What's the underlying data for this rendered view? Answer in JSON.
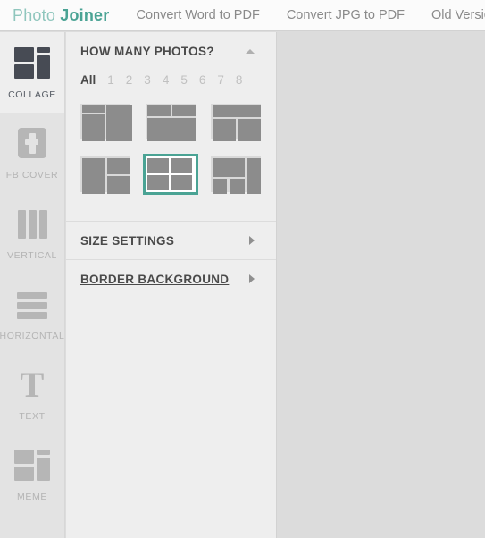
{
  "header": {
    "logo_part1": "Photo ",
    "logo_part2": "Joiner",
    "links": [
      {
        "label": "Convert Word to PDF"
      },
      {
        "label": "Convert JPG to PDF"
      },
      {
        "label": "Old Version"
      }
    ]
  },
  "sidebar": {
    "items": [
      {
        "label": "COLLAGE",
        "icon": "collage-icon",
        "active": true
      },
      {
        "label": "FB COVER",
        "icon": "facebook-icon",
        "active": false
      },
      {
        "label": "VERTICAL",
        "icon": "vertical-bars-icon",
        "active": false
      },
      {
        "label": "HORIZONTAL",
        "icon": "horizontal-bars-icon",
        "active": false
      },
      {
        "label": "TEXT",
        "icon": "text-t-icon",
        "active": false
      },
      {
        "label": "MEME",
        "icon": "meme-icon",
        "active": false
      }
    ]
  },
  "panel": {
    "how_many_photos": {
      "title": "HOW MANY PHOTOS?",
      "collapse_icon": "chevron-up-icon",
      "counts": [
        {
          "label": "All",
          "active": true
        },
        {
          "label": "1",
          "active": false
        },
        {
          "label": "2",
          "active": false
        },
        {
          "label": "3",
          "active": false
        },
        {
          "label": "4",
          "active": false
        },
        {
          "label": "5",
          "active": false
        },
        {
          "label": "6",
          "active": false
        },
        {
          "label": "7",
          "active": false
        },
        {
          "label": "8",
          "active": false
        }
      ],
      "templates": [
        {
          "name": "layout-left-split-right-full",
          "selected": false
        },
        {
          "name": "layout-two-top-one-bottom",
          "selected": false
        },
        {
          "name": "layout-one-top-two-bottom",
          "selected": false
        },
        {
          "name": "layout-left-full-right-split",
          "selected": false
        },
        {
          "name": "layout-two-by-two-grid",
          "selected": true
        },
        {
          "name": "layout-three-left-one-right",
          "selected": false
        }
      ]
    },
    "size_settings": {
      "title": "SIZE SETTINGS",
      "expand_icon": "chevron-right-icon",
      "underlined": false
    },
    "border_background": {
      "title": "BORDER BACKGROUND",
      "expand_icon": "chevron-right-icon",
      "underlined": true
    }
  },
  "colors": {
    "accent": "#4aa394",
    "logo_light": "#8fc6bd",
    "panel_bg": "#eeeeee",
    "rail_bg": "#e3e3e3",
    "canvas_bg": "#dcdcdc",
    "cell": "#8c8c8c"
  }
}
